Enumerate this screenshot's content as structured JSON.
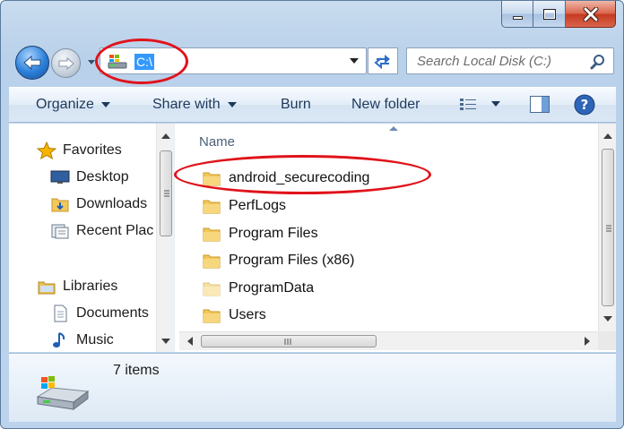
{
  "window": {
    "caption_min": "minimize",
    "caption_max": "maximize",
    "caption_close": "close"
  },
  "address": {
    "path": "C:\\",
    "icon": "drive-icon"
  },
  "search": {
    "placeholder": "Search Local Disk (C:)"
  },
  "toolbar": {
    "organize": "Organize",
    "share_with": "Share with",
    "burn": "Burn",
    "new_folder": "New folder"
  },
  "nav_pane": {
    "favorites": "Favorites",
    "desktop": "Desktop",
    "downloads": "Downloads",
    "recent": "Recent Plac",
    "libraries": "Libraries",
    "documents": "Documents",
    "music": "Music"
  },
  "file_list": {
    "column_name": "Name",
    "items": [
      "android_securecoding",
      "PerfLogs",
      "Program Files",
      "Program Files (x86)",
      "ProgramData",
      "Users"
    ]
  },
  "status": {
    "item_count": "7 items"
  },
  "colors": {
    "highlight_ellipse": "#e0131b",
    "selection": "#3399ff",
    "folder": "#f2c75c"
  }
}
